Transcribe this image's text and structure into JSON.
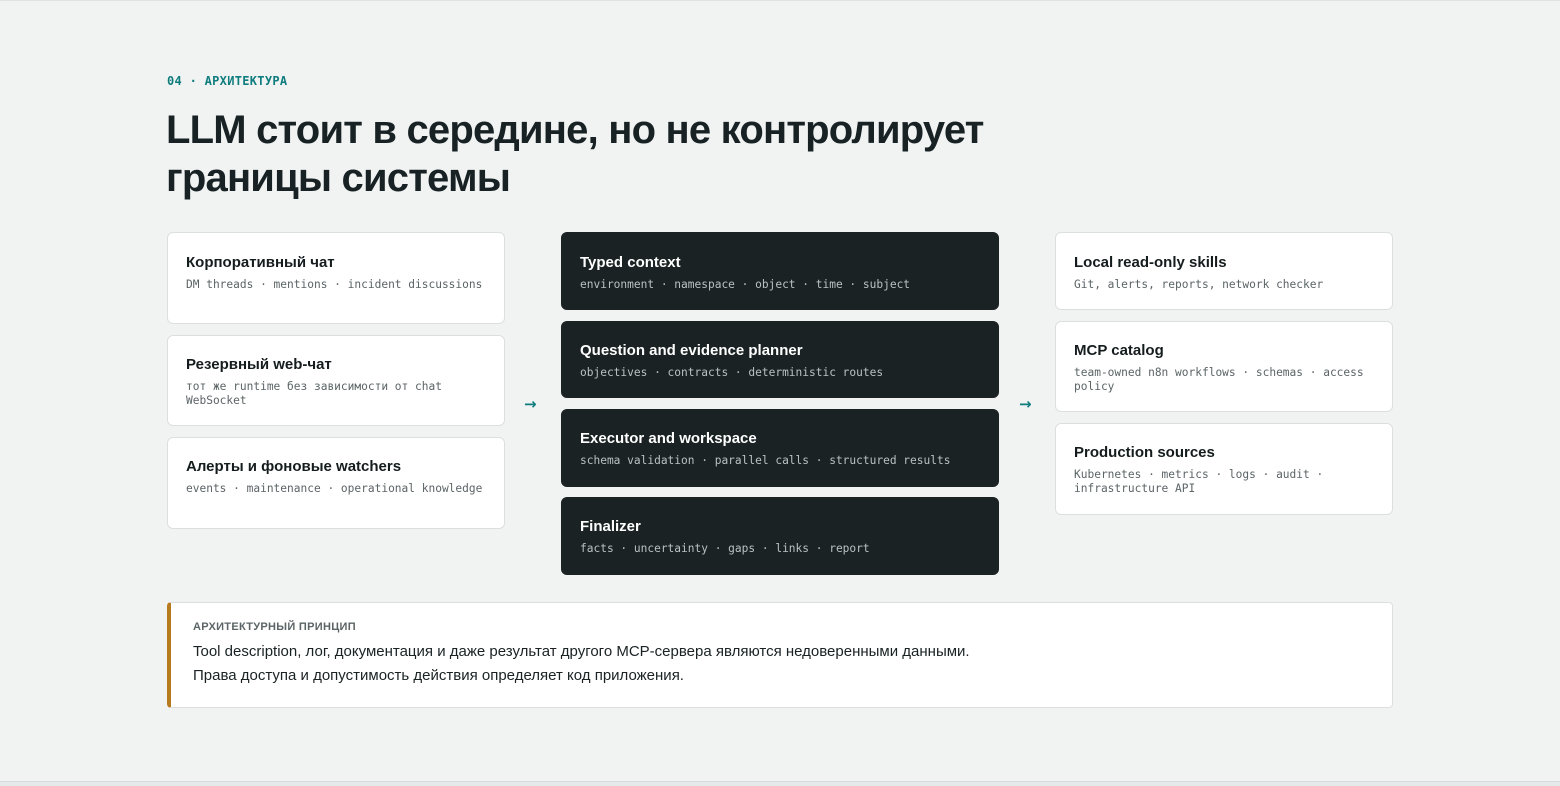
{
  "section": {
    "kicker": "04 · АРХИТЕКТУРА"
  },
  "heading": {
    "line1": "LLM стоит в середине, но не контролирует",
    "line2": "границы системы"
  },
  "left_column": [
    {
      "title": "Корпоративный чат",
      "subtitle": "DM threads · mentions · incident discussions"
    },
    {
      "title": "Резервный web-чат",
      "subtitle": "тот же runtime без зависимости от chat WebSocket"
    },
    {
      "title": "Алерты и фоновые watchers",
      "subtitle": "events · maintenance · operational knowledge"
    }
  ],
  "center_column": [
    {
      "title": "Typed context",
      "subtitle": "environment · namespace · object · time · subject"
    },
    {
      "title": "Question and evidence planner",
      "subtitle": "objectives · contracts · deterministic routes"
    },
    {
      "title": "Executor and workspace",
      "subtitle": "schema validation · parallel calls · structured results"
    },
    {
      "title": "Finalizer",
      "subtitle": "facts · uncertainty · gaps · links · report"
    }
  ],
  "right_column": [
    {
      "title": "Local read-only skills",
      "subtitle": "Git, alerts, reports, network checker"
    },
    {
      "title": "MCP catalog",
      "subtitle": "team-owned n8n workflows · schemas · access policy"
    },
    {
      "title": "Production sources",
      "subtitle": "Kubernetes · metrics · logs · audit · infrastructure API"
    }
  ],
  "arrows": {
    "left": "→",
    "right": "→"
  },
  "principle": {
    "label": "АРХИТЕКТУРНЫЙ ПРИНЦИП",
    "line1": "Tool description, лог, документация и даже результат другого MCP-сервера являются недоверенными данными.",
    "line2": "Права доступа и допустимость действия определяет код приложения."
  },
  "colors": {
    "accent": "#0f7c7e",
    "dark_card": "#1a2224",
    "principle_border": "#b87a1e",
    "background": "#f1f3f3"
  }
}
